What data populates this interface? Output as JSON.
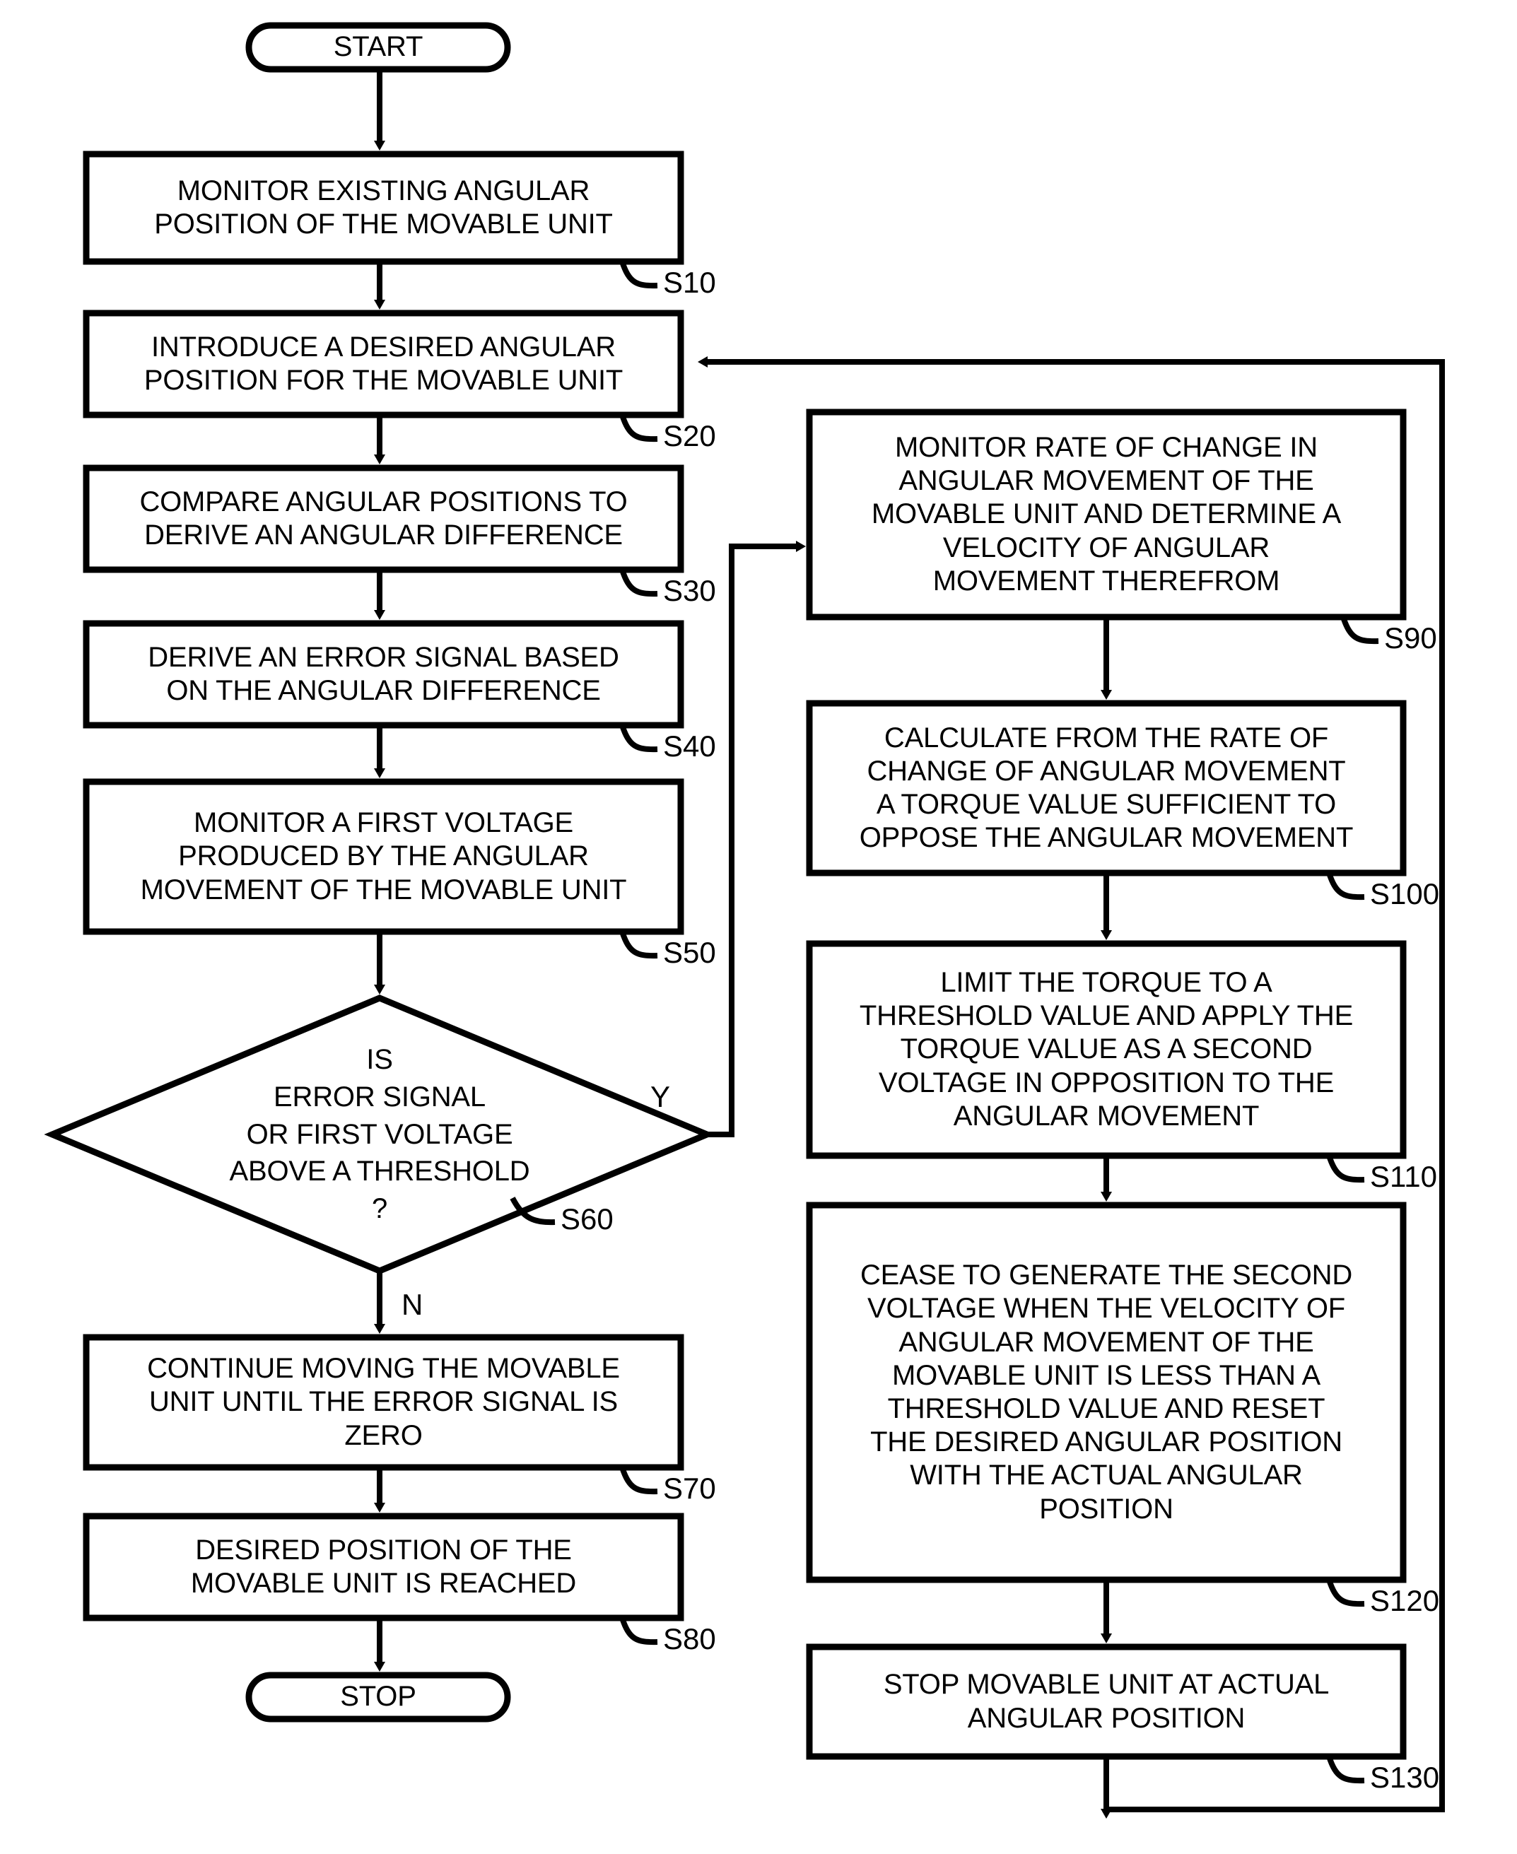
{
  "diagram": {
    "type": "flowchart",
    "title": "",
    "orientation": "two-column",
    "terminals": {
      "start": "START",
      "stop": "STOP"
    },
    "branch_labels": {
      "yes": "Y",
      "no": "N"
    },
    "nodes": [
      {
        "id": "start",
        "shape": "terminator",
        "text": "START",
        "step": ""
      },
      {
        "id": "s10",
        "shape": "process",
        "text": "MONITOR EXISTING ANGULAR POSITION OF THE MOVABLE UNIT",
        "step": "S10"
      },
      {
        "id": "s20",
        "shape": "process",
        "text": "INTRODUCE A DESIRED ANGULAR POSITION FOR THE MOVABLE UNIT",
        "step": "S20"
      },
      {
        "id": "s30",
        "shape": "process",
        "text": "COMPARE ANGULAR POSITIONS TO DERIVE AN ANGULAR DIFFERENCE",
        "step": "S30"
      },
      {
        "id": "s40",
        "shape": "process",
        "text": "DERIVE AN ERROR SIGNAL BASED ON THE ANGULAR DIFFERENCE",
        "step": "S40"
      },
      {
        "id": "s50",
        "shape": "process",
        "text": "MONITOR A FIRST VOLTAGE PRODUCED BY THE ANGULAR MOVEMENT OF THE MOVABLE UNIT",
        "step": "S50"
      },
      {
        "id": "s60",
        "shape": "decision",
        "text": "IS ERROR SIGNAL OR FIRST VOLTAGE ABOVE A THRESHOLD ?",
        "step": "S60"
      },
      {
        "id": "s70",
        "shape": "process",
        "text": "CONTINUE MOVING THE MOVABLE UNIT UNTIL THE ERROR SIGNAL IS ZERO",
        "step": "S70"
      },
      {
        "id": "s80",
        "shape": "process",
        "text": "DESIRED POSITION OF THE MOVABLE UNIT IS REACHED",
        "step": "S80"
      },
      {
        "id": "stop",
        "shape": "terminator",
        "text": "STOP",
        "step": ""
      },
      {
        "id": "s90",
        "shape": "process",
        "text": "MONITOR RATE OF CHANGE IN ANGULAR MOVEMENT OF THE MOVABLE UNIT AND DETERMINE A VELOCITY OF ANGULAR MOVEMENT THEREFROM",
        "step": "S90"
      },
      {
        "id": "s100",
        "shape": "process",
        "text": "CALCULATE FROM THE RATE OF CHANGE OF ANGULAR MOVEMENT A TORQUE VALUE SUFFICIENT TO OPPOSE THE ANGULAR MOVEMENT",
        "step": "S100"
      },
      {
        "id": "s110",
        "shape": "process",
        "text": "LIMIT THE TORQUE TO A THRESHOLD VALUE AND APPLY THE TORQUE VALUE AS A SECOND VOLTAGE IN OPPOSITION TO THE ANGULAR MOVEMENT",
        "step": "S110"
      },
      {
        "id": "s120",
        "shape": "process",
        "text": "CEASE TO GENERATE THE SECOND VOLTAGE WHEN THE VELOCITY OF ANGULAR MOVEMENT OF THE MOVABLE UNIT IS LESS THAN A THRESHOLD VALUE AND RESET THE DESIRED ANGULAR POSITION WITH THE ACTUAL ANGULAR POSITION",
        "step": "S120"
      },
      {
        "id": "s130",
        "shape": "process",
        "text": "STOP MOVABLE UNIT AT ACTUAL ANGULAR POSITION",
        "step": "S130"
      }
    ],
    "node_text_lines": {
      "start": [
        "START"
      ],
      "s10": [
        "MONITOR EXISTING ANGULAR",
        "POSITION OF THE MOVABLE UNIT"
      ],
      "s20": [
        "INTRODUCE A DESIRED ANGULAR",
        "POSITION FOR THE MOVABLE UNIT"
      ],
      "s30": [
        "COMPARE ANGULAR POSITIONS TO",
        "DERIVE AN ANGULAR DIFFERENCE"
      ],
      "s40": [
        "DERIVE AN ERROR SIGNAL BASED",
        "ON THE ANGULAR DIFFERENCE"
      ],
      "s50": [
        "MONITOR A FIRST VOLTAGE",
        "PRODUCED BY THE ANGULAR",
        "MOVEMENT OF THE MOVABLE UNIT"
      ],
      "s60": [
        "IS",
        "ERROR SIGNAL",
        "OR FIRST VOLTAGE",
        "ABOVE A THRESHOLD",
        "?"
      ],
      "s70": [
        "CONTINUE MOVING THE MOVABLE",
        "UNIT UNTIL THE ERROR SIGNAL IS",
        "ZERO"
      ],
      "s80": [
        "DESIRED POSITION OF THE",
        "MOVABLE UNIT IS REACHED"
      ],
      "stop": [
        "STOP"
      ],
      "s90": [
        "MONITOR RATE OF CHANGE IN",
        "ANGULAR MOVEMENT OF THE",
        "MOVABLE UNIT AND DETERMINE A",
        "VELOCITY OF ANGULAR",
        "MOVEMENT THEREFROM"
      ],
      "s100": [
        "CALCULATE FROM THE RATE OF",
        "CHANGE OF ANGULAR MOVEMENT",
        "A TORQUE VALUE SUFFICIENT TO",
        "OPPOSE THE ANGULAR MOVEMENT"
      ],
      "s110": [
        "LIMIT THE TORQUE TO A",
        "THRESHOLD VALUE AND APPLY THE",
        "TORQUE VALUE AS A SECOND",
        "VOLTAGE IN OPPOSITION TO THE",
        "ANGULAR MOVEMENT"
      ],
      "s120": [
        "CEASE TO GENERATE THE SECOND",
        "VOLTAGE WHEN THE VELOCITY OF",
        "ANGULAR MOVEMENT OF THE",
        "MOVABLE UNIT IS LESS THAN A",
        "THRESHOLD VALUE AND RESET",
        "THE DESIRED ANGULAR POSITION",
        "WITH THE ACTUAL ANGULAR",
        "POSITION"
      ],
      "s130": [
        "STOP MOVABLE UNIT AT ACTUAL",
        "ANGULAR POSITION"
      ]
    },
    "edges": [
      {
        "from": "start",
        "to": "s10",
        "label": ""
      },
      {
        "from": "s10",
        "to": "s20",
        "label": ""
      },
      {
        "from": "s20",
        "to": "s30",
        "label": ""
      },
      {
        "from": "s30",
        "to": "s40",
        "label": ""
      },
      {
        "from": "s40",
        "to": "s50",
        "label": ""
      },
      {
        "from": "s50",
        "to": "s60",
        "label": ""
      },
      {
        "from": "s60",
        "to": "s70",
        "label": "N"
      },
      {
        "from": "s60",
        "to": "s90",
        "label": "Y"
      },
      {
        "from": "s70",
        "to": "s80",
        "label": ""
      },
      {
        "from": "s80",
        "to": "stop",
        "label": ""
      },
      {
        "from": "s90",
        "to": "s100",
        "label": ""
      },
      {
        "from": "s100",
        "to": "s110",
        "label": ""
      },
      {
        "from": "s110",
        "to": "s120",
        "label": ""
      },
      {
        "from": "s120",
        "to": "s130",
        "label": ""
      },
      {
        "from": "s130",
        "to": "s20",
        "label": ""
      }
    ],
    "colors": {
      "stroke": "#000000",
      "fill": "#ffffff",
      "text": "#000000"
    }
  }
}
